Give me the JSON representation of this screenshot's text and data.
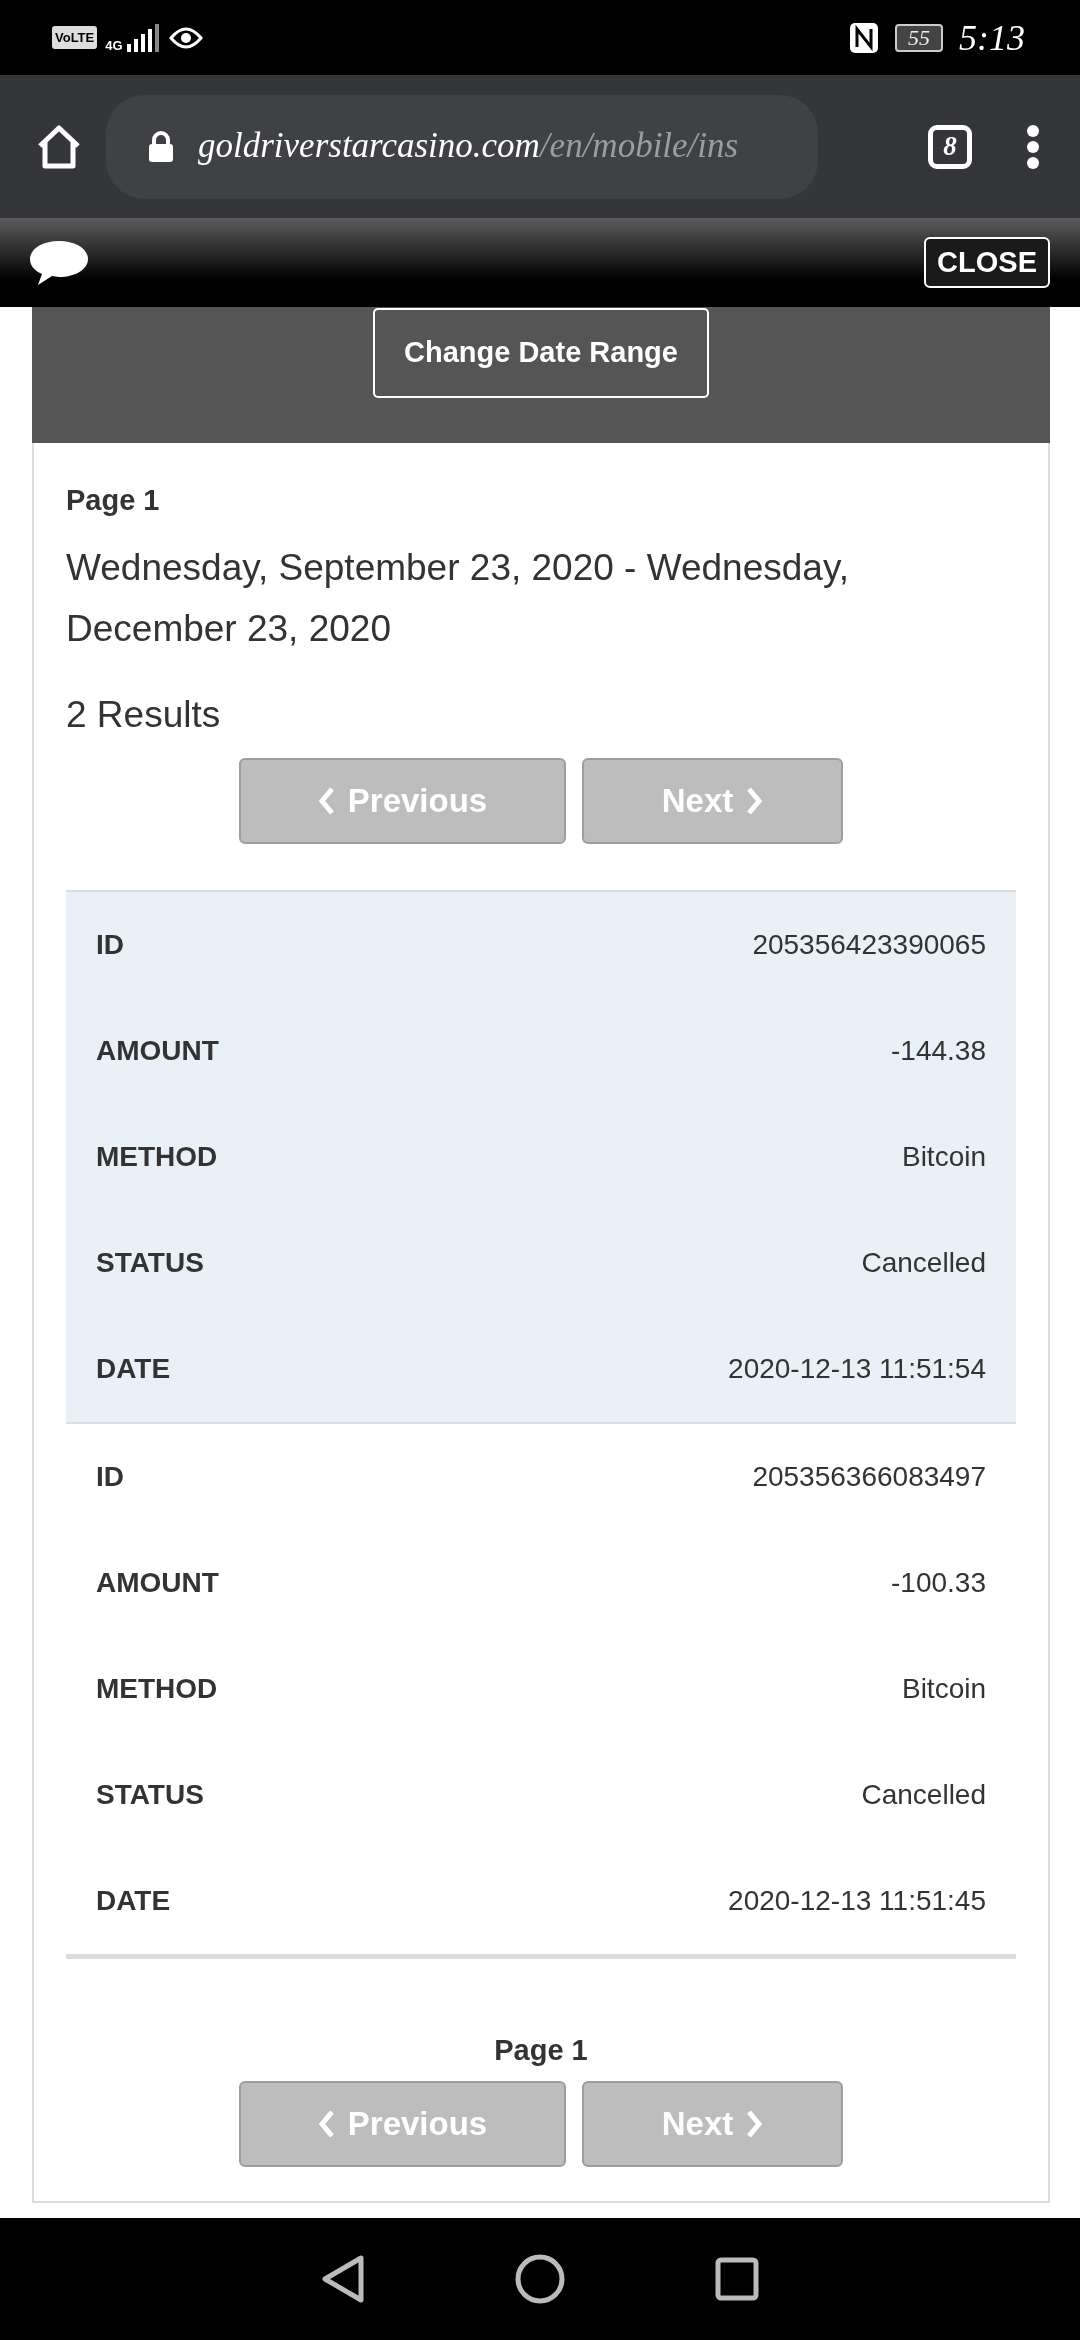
{
  "status_bar": {
    "network_badge": "VoLTE",
    "network_type": "4G",
    "battery": "55",
    "time": "5:13"
  },
  "browser": {
    "url_host": "goldriverstarcasino.com",
    "url_path": "/en/mobile/ins",
    "tab_count": "8"
  },
  "top_bar": {
    "close_button": "CLOSE"
  },
  "date_range_button": "Change Date Range",
  "header": {
    "page": "Page 1",
    "date_range": "Wednesday, September 23, 2020 - Wednesday, December 23, 2020",
    "results": "2 Results"
  },
  "pager_top": [
    {
      "label": "Previous",
      "kind": "prev",
      "disabled": true
    },
    {
      "label": "Next",
      "kind": "next",
      "disabled": true
    }
  ],
  "transactions": [
    {
      "selected": true,
      "fields": [
        {
          "label": "ID",
          "value": "205356423390065"
        },
        {
          "label": "AMOUNT",
          "value": "-144.38"
        },
        {
          "label": "METHOD",
          "value": "Bitcoin"
        },
        {
          "label": "STATUS",
          "value": "Cancelled"
        },
        {
          "label": "DATE",
          "value": "2020-12-13 11:51:54"
        }
      ]
    },
    {
      "selected": false,
      "fields": [
        {
          "label": "ID",
          "value": "205356366083497"
        },
        {
          "label": "AMOUNT",
          "value": "-100.33"
        },
        {
          "label": "METHOD",
          "value": "Bitcoin"
        },
        {
          "label": "STATUS",
          "value": "Cancelled"
        },
        {
          "label": "DATE",
          "value": "2020-12-13 11:51:45"
        }
      ]
    }
  ],
  "footer": {
    "page": "Page 1"
  },
  "pager_bottom": [
    {
      "label": "Previous",
      "kind": "prev",
      "disabled": true
    },
    {
      "label": "Next",
      "kind": "next",
      "disabled": true
    }
  ]
}
